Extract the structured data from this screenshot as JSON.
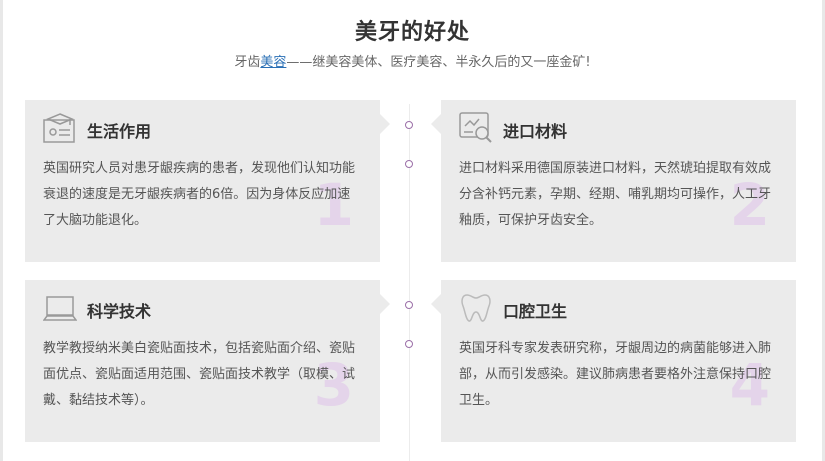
{
  "header": {
    "title": "美牙的好处",
    "subtitle_prefix": "牙齿",
    "subtitle_link": "美容",
    "subtitle_suffix": "——继美容美体、医疗美容、半永久后的又一座金矿!"
  },
  "colors": {
    "accent": "#9b6fa8",
    "card_bg": "#ebebeb",
    "link": "#2a6fb5",
    "number": "#e4d4ea"
  },
  "cards": [
    {
      "icon": "certificate-icon",
      "title": "生活作用",
      "number": "1",
      "text": "英国研究人员对患牙龈疾病的患者，发现他们认知功能衰退的速度是无牙龈疾病者的6倍。因为身体反应加速了大脑功能退化。"
    },
    {
      "icon": "material-search-icon",
      "title": "进口材料",
      "number": "2",
      "text": "进口材料采用德国原装进口材料，天然琥珀提取有效成分含补钙元素，孕期、经期、哺乳期均可操作，人工牙釉质，可保护牙齿安全。"
    },
    {
      "icon": "laptop-icon",
      "title": "科学技术",
      "number": "3",
      "text": "教学教授纳米美白瓷贴面技术，包括瓷贴面介绍、瓷贴面优点、瓷贴面适用范围、瓷贴面技术教学（取模、试戴、黏结技术等）。"
    },
    {
      "icon": "tooth-icon",
      "title": "口腔卫生",
      "number": "4",
      "text": "英国牙科专家发表研究称，牙龈周边的病菌能够进入肺部，从而引发感染。建议肺病患者要格外注意保持口腔卫生。"
    }
  ]
}
